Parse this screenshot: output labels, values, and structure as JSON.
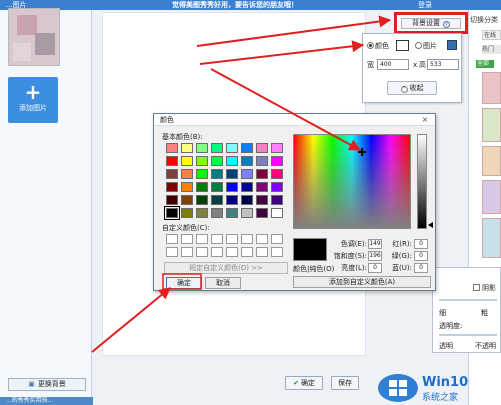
{
  "topbar": {
    "title": "...图片",
    "message": "觉得美图秀秀好用，要告诉您的朋友哦！",
    "right": "登录"
  },
  "left": {
    "add_image": "添加图片",
    "change_bg": "更换背景",
    "bottom_text": "...的秀秀实用技..."
  },
  "canvas": {
    "confirm": "确定",
    "save": "保存"
  },
  "right": {
    "switch_category": "切换分类",
    "sub_online": "在线",
    "sub_hot": "热门",
    "badge_all": "全部"
  },
  "bg_settings": {
    "button": "背景设置",
    "radio_color": "颜色",
    "radio_image": "图片",
    "width_label": "宽",
    "width_value": "400",
    "times": "x",
    "height_label": "高",
    "height_value": "533",
    "collapse": "收起"
  },
  "lower_dialog": {
    "shadow": "阴影",
    "thin": "细",
    "thick": "粗",
    "opacity": "透明度:",
    "transparent": "透明",
    "opaque": "不透明"
  },
  "color_dialog": {
    "title": "颜色",
    "close": "×",
    "basic_colors": "基本颜色(B):",
    "custom_colors": "自定义颜色(C):",
    "define_custom": "规定自定义颜色(D) >>",
    "ok": "确定",
    "cancel": "取消",
    "preview_label": "颜色|纯色(O)",
    "hue_label": "色调(E):",
    "hue": "149",
    "sat_label": "饱和度(S):",
    "sat": "196",
    "lum_label": "亮度(L):",
    "lum": "0",
    "red_label": "红(R):",
    "red": "0",
    "green_label": "绿(G):",
    "green": "0",
    "blue_label": "蓝(U):",
    "blue": "0",
    "add_custom": "添加到自定义颜色(A)",
    "basic_swatches": [
      "#ff8080",
      "#ffff80",
      "#80ff80",
      "#00ff80",
      "#80ffff",
      "#0080ff",
      "#ff80c0",
      "#ff80ff",
      "#ff0000",
      "#ffff00",
      "#80ff00",
      "#00ff40",
      "#00ffff",
      "#0080c0",
      "#8080c0",
      "#ff00ff",
      "#804040",
      "#ff8040",
      "#00ff00",
      "#008080",
      "#004080",
      "#8080ff",
      "#800040",
      "#ff0080",
      "#800000",
      "#ff8000",
      "#008000",
      "#008040",
      "#0000ff",
      "#0000a0",
      "#800080",
      "#8000ff",
      "#400000",
      "#804000",
      "#004000",
      "#004040",
      "#000080",
      "#000040",
      "#400040",
      "#400080",
      "#000000",
      "#808000",
      "#808040",
      "#808080",
      "#408080",
      "#c0c0c0",
      "#400040",
      "#ffffff"
    ],
    "selected_swatch_index": 40
  },
  "watermark": {
    "brand": "Win10",
    "sub": "系统之家"
  },
  "colors": {
    "annotation_red": "#e02020",
    "titlebar_blue": "#3b7fd0",
    "add_button_blue": "#3c8ee0"
  }
}
